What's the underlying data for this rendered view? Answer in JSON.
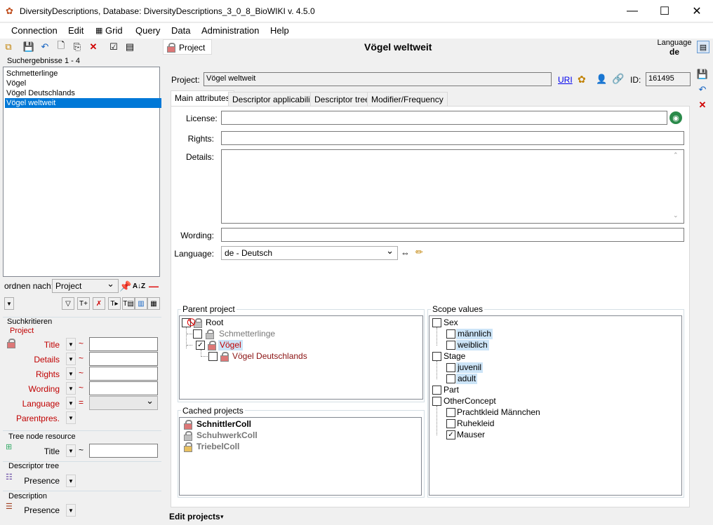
{
  "window": {
    "title": "DiversityDescriptions,  Database: DiversityDescriptions_3_0_8_BioWIKI    v. 4.5.0",
    "minimize": "—",
    "maximize": "☐",
    "close": "✕"
  },
  "menu": [
    "Connection",
    "Edit",
    "Grid",
    "Query",
    "Data",
    "Administration",
    "Help"
  ],
  "toolbar": {
    "project_tab": "Project",
    "heading": "Vögel weltweit",
    "language_label": "Language",
    "language_value": "de"
  },
  "search": {
    "results_label": "Suchergebnisse   1 - 4",
    "items": [
      "Schmetterlinge",
      "Vögel",
      "Vögel Deutschlands",
      "Vögel weltweit"
    ],
    "selected_index": 3,
    "order_label": "ordnen nach:",
    "order_value": "Project"
  },
  "criteria": {
    "header": "Suchkritieren",
    "section_project": "Project",
    "fields": [
      {
        "label": "Title",
        "op": "~"
      },
      {
        "label": "Details",
        "op": "~"
      },
      {
        "label": "Rights",
        "op": "~"
      },
      {
        "label": "Wording",
        "op": "~"
      },
      {
        "label": "Language",
        "op": "="
      },
      {
        "label": "Parentpres.",
        "op": ""
      }
    ],
    "tree_node_header": "Tree node resource",
    "tree_node_field": "Title",
    "tree_node_op": "~",
    "descriptor_tree_header": "Descriptor tree",
    "descriptor_tree_field": "Presence",
    "description_header": "Description",
    "description_field": "Presence"
  },
  "project": {
    "label": "Project:",
    "value": "Vögel weltweit",
    "uri": "URI",
    "id_label": "ID:",
    "id_value": "161495"
  },
  "tabs": [
    "Main attributes",
    "Descriptor applicability",
    "Descriptor tree",
    "Modifier/Frequency"
  ],
  "main": {
    "license_label": "License:",
    "license_value": "",
    "rights_label": "Rights:",
    "rights_value": "",
    "details_label": "Details:",
    "details_value": "",
    "wording_label": "Wording:",
    "wording_value": "",
    "language_label": "Language:",
    "language_value": "de - Deutsch",
    "swap_symbol": "⇔"
  },
  "parent_project": {
    "header": "Parent project",
    "nodes": [
      {
        "label": "Root",
        "checked": false
      },
      {
        "label": "Schmetterlinge",
        "checked": false
      },
      {
        "label": "Vögel",
        "checked": true
      },
      {
        "label": "Vögel Deutschlands",
        "checked": false
      }
    ]
  },
  "cached_projects": {
    "header": "Cached projects",
    "items": [
      "SchnittlerColl",
      "SchuhwerkColl",
      "TriebelColl"
    ]
  },
  "scope_values": {
    "header": "Scope values",
    "nodes": [
      {
        "label": "Sex",
        "checked": false
      },
      {
        "label": "männlich",
        "checked": false
      },
      {
        "label": "weiblich",
        "checked": false
      },
      {
        "label": "Stage",
        "checked": false
      },
      {
        "label": "juvenil",
        "checked": false
      },
      {
        "label": "adult",
        "checked": false
      },
      {
        "label": "Part",
        "checked": false
      },
      {
        "label": "OtherConcept",
        "checked": false
      },
      {
        "label": "Prachtkleid Männchen",
        "checked": false
      },
      {
        "label": "Ruhekleid",
        "checked": false
      },
      {
        "label": "Mauser",
        "checked": true
      }
    ]
  },
  "footer": {
    "label": "Edit projects"
  }
}
